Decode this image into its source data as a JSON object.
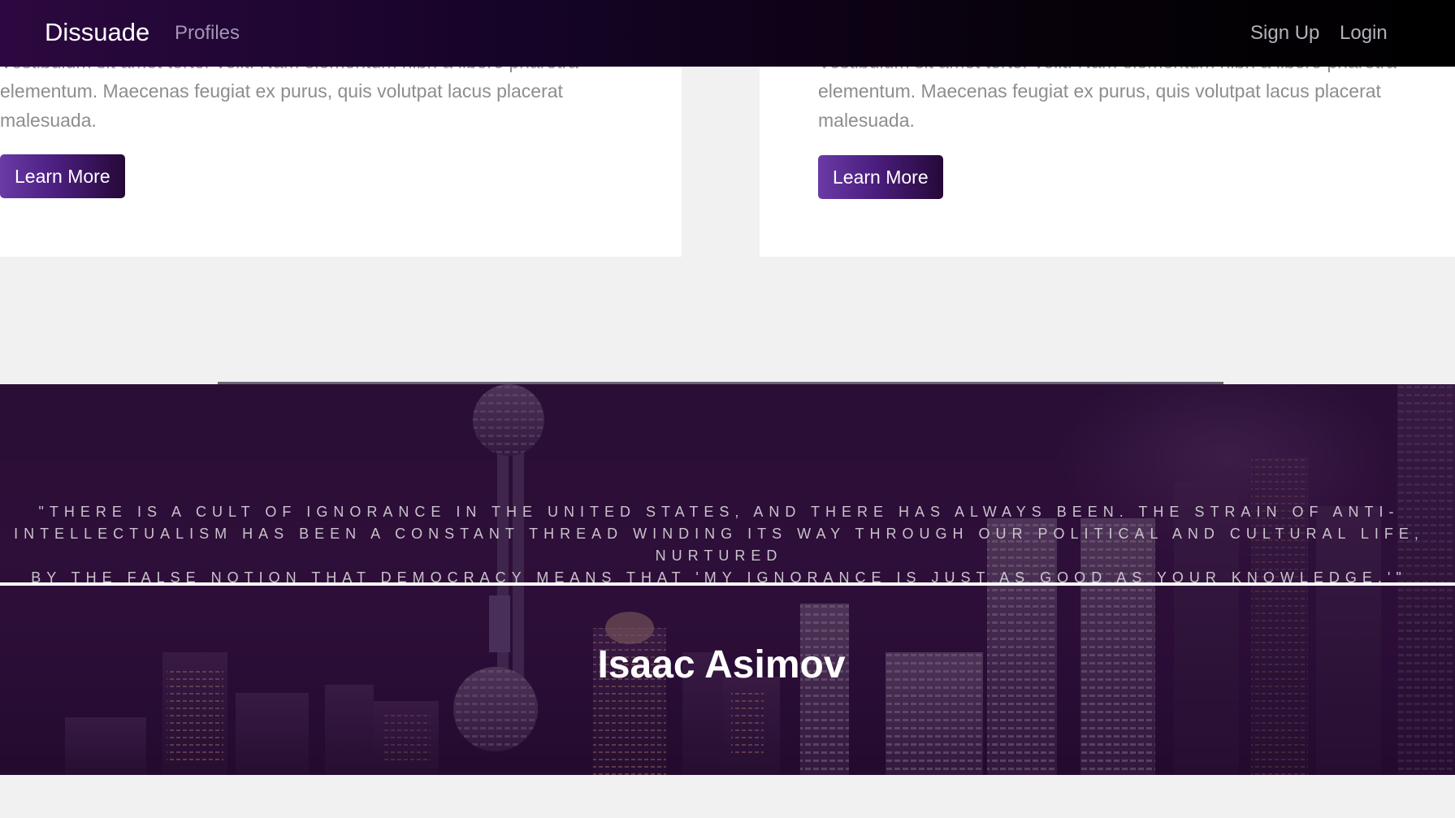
{
  "navbar": {
    "brand": "Dissuade",
    "links": {
      "profiles": "Profiles",
      "signup": "Sign Up",
      "login": "Login"
    }
  },
  "cards": [
    {
      "text": "Vestibulum sit amet tortor velit. Nam elementum nibh a libero pharetra elementum. Maecenas feugiat ex purus, quis volutpat lacus placerat malesuada.",
      "button": "Learn More"
    },
    {
      "text": "Vestibulum sit amet tortor velit. Nam elementum nibh a libero pharetra elementum. Maecenas feugiat ex purus, quis volutpat lacus placerat malesuada.",
      "button": "Learn More"
    }
  ],
  "quote": {
    "text": "\"There is a cult of ignorance in the United States, and there has always been. The strain of anti-intellectualism has been a constant thread winding its way through our political and cultural life, nurtured\nby the false notion that democracy means that 'my ignorance is just as good as your knowledge.'\"",
    "author": "Isaac Asimov"
  },
  "colors": {
    "accent": "#5a2a8f",
    "nav_start": "#2c0840",
    "nav_end": "#000000"
  }
}
